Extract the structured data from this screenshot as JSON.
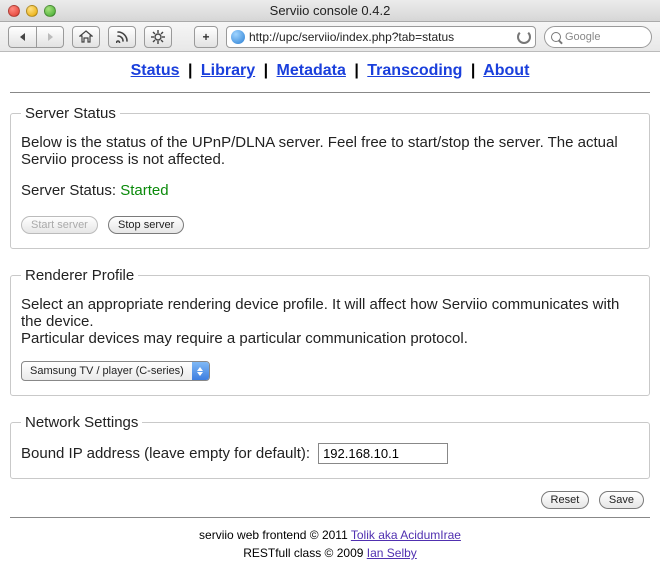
{
  "window": {
    "title": "Serviio console 0.4.2"
  },
  "browser": {
    "url": "http://upc/serviio/index.php?tab=status",
    "search_placeholder": "Google"
  },
  "nav": {
    "status": "Status",
    "library": "Library",
    "metadata": "Metadata",
    "transcoding": "Transcoding",
    "about": "About"
  },
  "server_status": {
    "legend": "Server Status",
    "desc": "Below is the status of the UPnP/DLNA server. Feel free to start/stop the server. The actual Serviio process is not affected.",
    "label": "Server Status: ",
    "value": "Started",
    "start_btn": "Start server",
    "stop_btn": "Stop server"
  },
  "renderer": {
    "legend": "Renderer Profile",
    "desc1": "Select an appropriate rendering device profile. It will affect how Serviio communicates with the device.",
    "desc2": "Particular devices may require a particular communication protocol.",
    "selected": "Samsung TV / player (C-series)"
  },
  "network": {
    "legend": "Network Settings",
    "bound_label": "Bound IP address (leave empty for default): ",
    "bound_value": "192.168.10.1"
  },
  "buttons": {
    "reset": "Reset",
    "save": "Save"
  },
  "footer": {
    "line1_pre": "serviio web frontend © 2011 ",
    "line1_link": "Tolik aka AcidumIrae",
    "line2_pre": "RESTfull class © 2009 ",
    "line2_link": "Ian Selby"
  }
}
